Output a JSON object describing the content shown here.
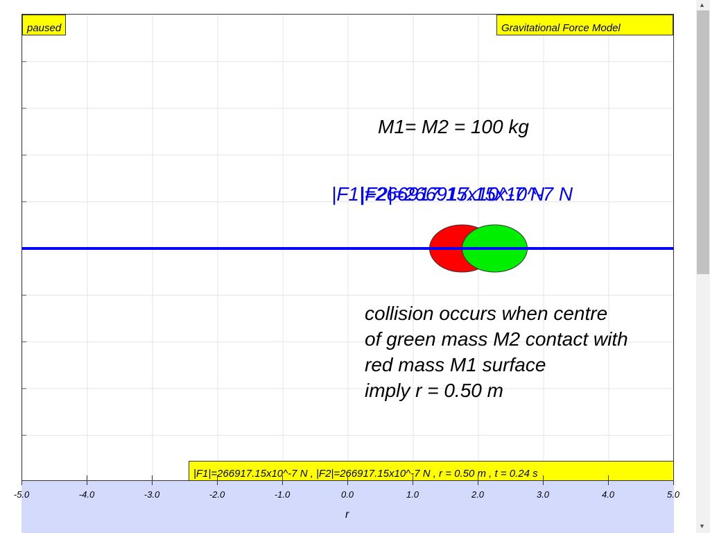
{
  "status": "paused",
  "title": "Gravitational Force Model",
  "mass_label": "M1= M2 = 100 kg",
  "f1_label": "|F1|=266917.15x10^-7 N",
  "f2_label": "|F2|=266917.15x10^-7 N",
  "note": [
    "collision occurs when centre",
    "of green mass M2 contact with",
    "red mass M1 surface",
    "imply r = 0.50 m"
  ],
  "readout": "|F1|=266917.15x10^-7 N , |F2|=266917.15x10^-7 N , r = 0.50 m , t = 0.24 s",
  "x_axis": {
    "label": "r",
    "ticks": [
      "-5.0",
      "-4.0",
      "-3.0",
      "-2.0",
      "-1.0",
      "0.0",
      "1.0",
      "2.0",
      "3.0",
      "4.0",
      "5.0"
    ],
    "range": [
      -5,
      5
    ]
  },
  "masses": [
    {
      "name": "M1",
      "x": 1.75,
      "radius": 0.5,
      "color": "#ff0000"
    },
    {
      "name": "M2",
      "x": 2.25,
      "radius": 0.5,
      "color": "#00ee00"
    }
  ],
  "line_color": "#0000ff"
}
